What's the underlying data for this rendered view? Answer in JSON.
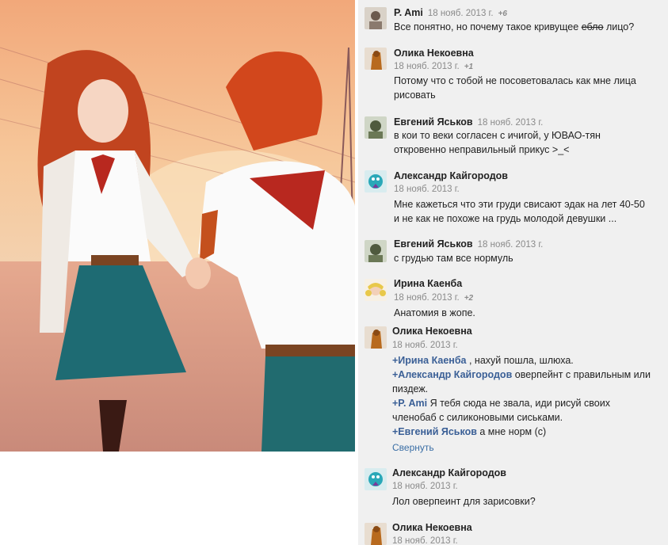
{
  "comments": [
    {
      "author": "P. Ami",
      "date": "18 нояб. 2013 г.",
      "likes": "+6",
      "text_before": "Все понятно, но почему такое кривущее ",
      "text_strike": "ебло",
      "text_after": " лицо?"
    },
    {
      "author": "Олика Некоевна",
      "date": "18 нояб. 2013 г.",
      "likes": "+1",
      "line1": "Потому что с тобой не посоветовалась как мне лица",
      "line2": "рисовать"
    },
    {
      "author": "Евгений Яськов",
      "date": "18 нояб. 2013 г.",
      "line1": "в кои то веки согласен с ичигой, у ЮВАО-тян",
      "line2": "откровенно неправильный прикус >_<"
    },
    {
      "author": "Александр Кайгородов",
      "date": "18 нояб. 2013 г.",
      "line1": "Мне кажеться что эти груди свисают эдак на лет 40-50",
      "line2": "и не как не похоже на грудь молодой девушки ..."
    },
    {
      "author": "Евгений Яськов",
      "date": "18 нояб. 2013 г.",
      "line1": "с грудью там все нормуль"
    },
    {
      "author": "Ирина Каенба",
      "date": "18 нояб. 2013 г.",
      "likes": "+2",
      "line1": "Анатомия в жопе."
    },
    {
      "author": "Олика Некоевна",
      "date": "18 нояб. 2013 г.",
      "r1_mention": "+Ирина Каенба",
      "r1_text": " , нахуй пошла, шлюха.",
      "r2_mention": "+Александр Кайгородов",
      "r2_text": " оверпейнт с правильным или",
      "r2_line2": "пиздеж.",
      "r3_mention": "+P. Ami",
      "r3_text": " Я тебя сюда не звала, иди рисуй своих",
      "r3_line2": "членобаб с силиконовыми сиськами.",
      "r4_mention": "+Евгений Яськов",
      "r4_text": " а мне норм (с)",
      "collapse": "Свернуть"
    },
    {
      "author": "Александр Кайгородов",
      "date": "18 нояб. 2013 г.",
      "line1": "Лол оверпеинт для зарисовки?"
    },
    {
      "author": "Олика Некоевна",
      "date": "18 нояб. 2013 г."
    }
  ],
  "colors": {
    "panel_bg": "#f0f0f0",
    "mention": "#3a5f96",
    "link": "#3a6ea5"
  },
  "icons": [
    "avatar-p-ami",
    "avatar-olika",
    "avatar-evgeny",
    "avatar-alexander",
    "avatar-irina"
  ]
}
